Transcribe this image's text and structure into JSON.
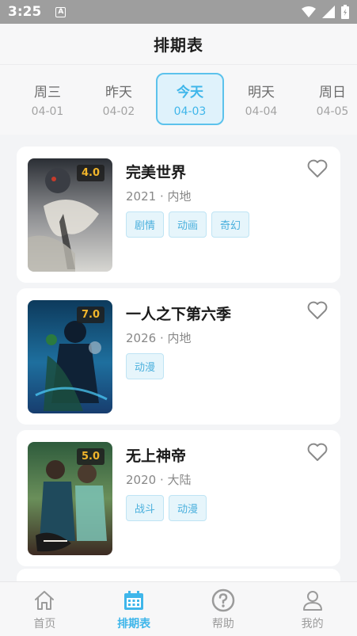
{
  "status_bar": {
    "time": "3:25",
    "notification_badge": "A",
    "icons": [
      "wifi-icon",
      "signal-icon",
      "battery-icon"
    ]
  },
  "header": {
    "title": "排期表"
  },
  "days": [
    {
      "name": "周三",
      "date": "04-01",
      "active": false
    },
    {
      "name": "昨天",
      "date": "04-02",
      "active": false
    },
    {
      "name": "今天",
      "date": "04-03",
      "active": true
    },
    {
      "name": "明天",
      "date": "04-04",
      "active": false
    },
    {
      "name": "周日",
      "date": "04-05",
      "active": false
    }
  ],
  "shows": [
    {
      "title": "完美世界",
      "meta": "2021 · 内地",
      "rating": "4.0",
      "tags": [
        "剧情",
        "动画",
        "奇幻"
      ]
    },
    {
      "title": "一人之下第六季",
      "meta": "2026 · 内地",
      "rating": "7.0",
      "tags": [
        "动漫"
      ]
    },
    {
      "title": "无上神帝",
      "meta": "2020 · 大陆",
      "rating": "5.0",
      "tags": [
        "战斗",
        "动漫"
      ]
    }
  ],
  "bottom_nav": [
    {
      "label": "首页",
      "icon": "home-icon",
      "active": false
    },
    {
      "label": "排期表",
      "icon": "calendar-icon",
      "active": true
    },
    {
      "label": "帮助",
      "icon": "help-icon",
      "active": false
    },
    {
      "label": "我的",
      "icon": "user-icon",
      "active": false
    }
  ],
  "colors": {
    "accent": "#3fb6ea",
    "rating": "#f1b52b",
    "tag_text": "#4bb0dd",
    "tag_bg": "#e6f5fb"
  }
}
